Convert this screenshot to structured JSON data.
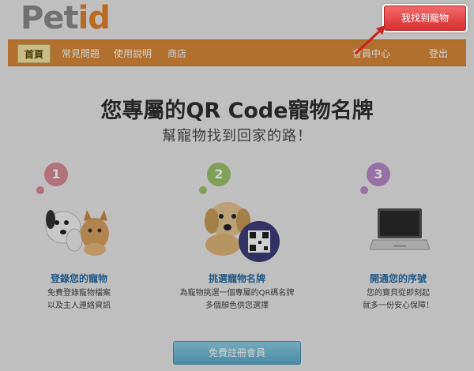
{
  "logo": {
    "part1": "Pet",
    "part2": "id"
  },
  "header": {
    "find_pet_button": "我找到寵物"
  },
  "nav": {
    "left": [
      "首頁",
      "常見問題",
      "使用說明",
      "商店"
    ],
    "right": [
      "會員中心",
      "登出"
    ]
  },
  "hero": {
    "headline": "您專屬的QR Code寵物名牌",
    "subline": "幫寵物找到回家的路！"
  },
  "steps": [
    {
      "number": "1",
      "title": "登錄您的寵物",
      "desc_line1": "免費登錄寵物檔案",
      "desc_line2": "以及主人連絡資訊",
      "color": "#d98b98",
      "icon": "puppy-kitten-image"
    },
    {
      "number": "2",
      "title": "挑選寵物名牌",
      "desc_line1": "為寵物挑選一個專屬的QR碼名牌",
      "desc_line2": "多個顏色供您選擇",
      "color": "#9bc46a",
      "icon": "dog-with-qr-tag-image"
    },
    {
      "number": "3",
      "title": "開通您的序號",
      "desc_line1": "您的寶貝從即刻起",
      "desc_line2": "就多一份安心保障！",
      "color": "#b78ac9",
      "icon": "laptop-image"
    }
  ],
  "register_button": "免費註冊會員",
  "colors": {
    "brand_orange": "#d8893a",
    "cta_red": "#d8302f",
    "link_blue": "#2c6ba1"
  }
}
